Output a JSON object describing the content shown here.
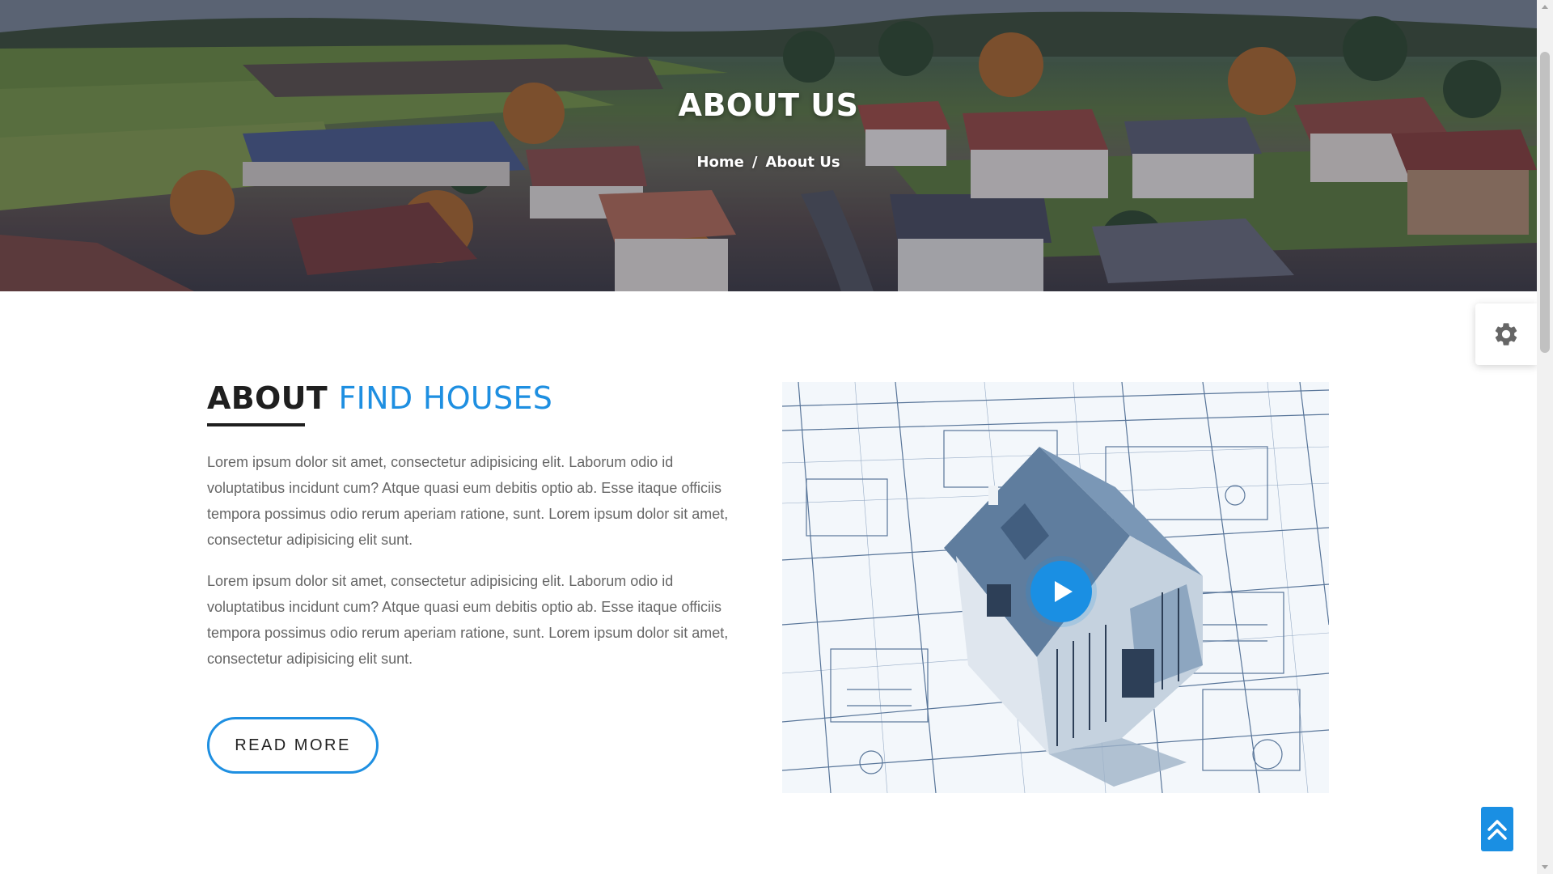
{
  "hero": {
    "title": "ABOUT US",
    "breadcrumb": {
      "home": "Home",
      "separator": "/",
      "current": "About Us"
    }
  },
  "about": {
    "heading_dark": "ABOUT",
    "heading_accent": "FIND HOUSES",
    "paragraphs": [
      "Lorem ipsum dolor sit amet, consectetur adipisicing elit. Laborum odio id voluptatibus incidunt cum? Atque quasi eum debitis optio ab. Esse itaque officiis tempora possimus odio rerum aperiam ratione, sunt. Lorem ipsum dolor sit amet, consectetur adipisicing elit sunt.",
      "Lorem ipsum dolor sit amet, consectetur adipisicing elit. Laborum odio id voluptatibus incidunt cum? Atque quasi eum debitis optio ab. Esse itaque officiis tempora possimus odio rerum aperiam ratione, sunt. Lorem ipsum dolor sit amet, consectetur adipisicing elit sunt."
    ],
    "read_more_label": "READ MORE"
  },
  "icons": {
    "play": "play-icon",
    "settings": "gear-icon",
    "back_to_top": "double-chevron-up-icon"
  },
  "colors": {
    "accent": "#1e8fe1",
    "heading_dark": "#1f1f1f",
    "body_text": "#666666",
    "button_blue": "#1a8fe3"
  }
}
